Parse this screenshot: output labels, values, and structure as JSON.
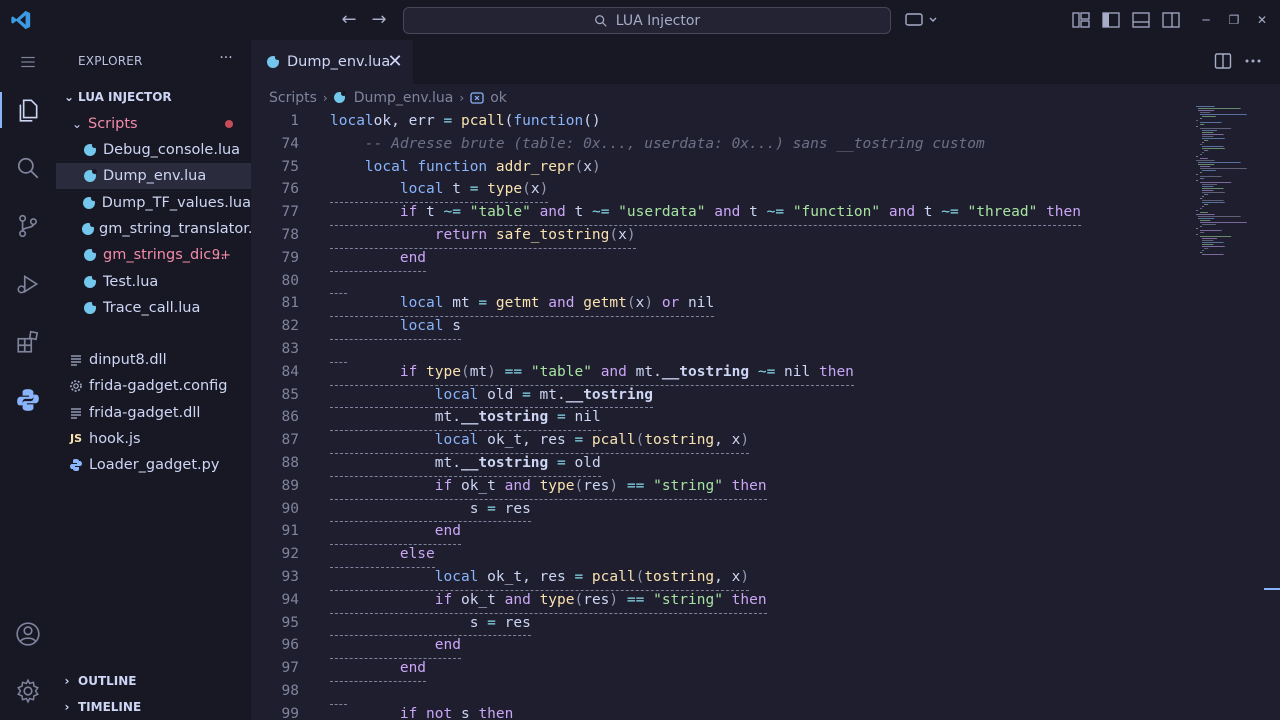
{
  "title_bar": {
    "search_text": "LUA Injector",
    "back_icon": "arrow-left-icon",
    "forward_icon": "arrow-right-icon"
  },
  "explorer": {
    "header": "EXPLORER",
    "more_label": "···",
    "root": "LUA INJECTOR",
    "folder": "Scripts",
    "files_in_folder": [
      {
        "name": "Debug_console.lua"
      },
      {
        "name": "Dump_env.lua"
      },
      {
        "name": "Dump_TF_values.lua"
      },
      {
        "name": "gm_string_translator..."
      },
      {
        "name": "gm_strings_dic...",
        "badge": "9+"
      },
      {
        "name": "Test.lua"
      },
      {
        "name": "Trace_call.lua"
      }
    ],
    "files_root": [
      {
        "name": "dinput8.dll"
      },
      {
        "name": "frida-gadget.config"
      },
      {
        "name": "frida-gadget.dll"
      },
      {
        "name": "hook.js",
        "icon_text": "JS"
      },
      {
        "name": "Loader_gadget.py"
      }
    ],
    "outline": "OUTLINE",
    "timeline": "TIMELINE"
  },
  "editor": {
    "tab_label": "Dump_env.lua",
    "close_glyph": "✕",
    "breadcrumb": [
      "Scripts",
      "Dump_env.lua",
      "ok"
    ],
    "lines": [
      {
        "n": "1",
        "indent": 0,
        "sticky": true,
        "t": [
          [
            "kw",
            "local"
          ],
          [
            "",
            "ok, err "
          ],
          [
            "op",
            "="
          ],
          [
            "",
            " "
          ],
          [
            "fn",
            "pcall"
          ],
          [
            "",
            "("
          ],
          [
            "kw",
            "function"
          ],
          [
            "",
            "()"
          ]
        ]
      },
      {
        "n": "74",
        "indent": 1,
        "sticky": true,
        "t": [
          [
            "cmt",
            "-- Adresse brute (table: 0x..., userdata: 0x...) sans __tostring custom"
          ]
        ]
      },
      {
        "n": "75",
        "indent": 1,
        "sticky": true,
        "t": [
          [
            "kw",
            "local"
          ],
          [
            "",
            " "
          ],
          [
            "kw",
            "function"
          ],
          [
            "",
            " "
          ],
          [
            "fn",
            "addr_repr"
          ],
          [
            "p",
            "("
          ],
          [
            "",
            "x"
          ],
          [
            "p",
            ")"
          ]
        ]
      },
      {
        "n": "76",
        "indent": 2,
        "u": true,
        "t": [
          [
            "kw",
            "local"
          ],
          [
            "",
            " t "
          ],
          [
            "op",
            "="
          ],
          [
            "",
            " "
          ],
          [
            "fn",
            "type"
          ],
          [
            "p",
            "("
          ],
          [
            "",
            "x"
          ],
          [
            "p",
            ")"
          ]
        ]
      },
      {
        "n": "77",
        "indent": 2,
        "u": true,
        "t": [
          [
            "kwc",
            "if"
          ],
          [
            "",
            " t "
          ],
          [
            "op",
            "~="
          ],
          [
            "",
            " "
          ],
          [
            "str",
            "\"table\""
          ],
          [
            "",
            " "
          ],
          [
            "kwc",
            "and"
          ],
          [
            "",
            " t "
          ],
          [
            "op",
            "~="
          ],
          [
            "",
            " "
          ],
          [
            "str",
            "\"userdata\""
          ],
          [
            "",
            " "
          ],
          [
            "kwc",
            "and"
          ],
          [
            "",
            " t "
          ],
          [
            "op",
            "~="
          ],
          [
            "",
            " "
          ],
          [
            "str",
            "\"function\""
          ],
          [
            "",
            " "
          ],
          [
            "kwc",
            "and"
          ],
          [
            "",
            " t "
          ],
          [
            "op",
            "~="
          ],
          [
            "",
            " "
          ],
          [
            "str",
            "\"thread\""
          ],
          [
            "",
            " "
          ],
          [
            "kwc",
            "then"
          ]
        ]
      },
      {
        "n": "78",
        "indent": 3,
        "u": true,
        "t": [
          [
            "kwc",
            "return"
          ],
          [
            "",
            " "
          ],
          [
            "fn",
            "safe_tostring"
          ],
          [
            "p",
            "("
          ],
          [
            "",
            "x"
          ],
          [
            "p",
            ")"
          ]
        ]
      },
      {
        "n": "79",
        "indent": 2,
        "u": true,
        "t": [
          [
            "kwc",
            "end"
          ]
        ]
      },
      {
        "n": "80",
        "indent": 0,
        "u": true,
        "t": [
          [
            "",
            ""
          ]
        ]
      },
      {
        "n": "81",
        "indent": 2,
        "u": true,
        "t": [
          [
            "kw",
            "local"
          ],
          [
            "",
            " mt "
          ],
          [
            "op",
            "="
          ],
          [
            "",
            " "
          ],
          [
            "fn",
            "getmt"
          ],
          [
            "",
            " "
          ],
          [
            "kwc",
            "and"
          ],
          [
            "",
            " "
          ],
          [
            "fn",
            "getmt"
          ],
          [
            "p",
            "("
          ],
          [
            "",
            "x"
          ],
          [
            "p",
            ")"
          ],
          [
            "",
            " "
          ],
          [
            "kwc",
            "or"
          ],
          [
            "",
            " nil"
          ]
        ]
      },
      {
        "n": "82",
        "indent": 2,
        "u": true,
        "t": [
          [
            "kw",
            "local"
          ],
          [
            "",
            " s"
          ]
        ]
      },
      {
        "n": "83",
        "indent": 0,
        "u": true,
        "t": [
          [
            "",
            ""
          ]
        ]
      },
      {
        "n": "84",
        "indent": 2,
        "u": true,
        "t": [
          [
            "kwc",
            "if"
          ],
          [
            "",
            " "
          ],
          [
            "fn",
            "type"
          ],
          [
            "p",
            "("
          ],
          [
            "",
            "mt"
          ],
          [
            "p",
            ")"
          ],
          [
            "",
            " "
          ],
          [
            "op",
            "=="
          ],
          [
            "",
            " "
          ],
          [
            "str",
            "\"table\""
          ],
          [
            "",
            " "
          ],
          [
            "kwc",
            "and"
          ],
          [
            "",
            " mt."
          ],
          [
            "b",
            "__tostring"
          ],
          [
            "",
            " "
          ],
          [
            "op",
            "~="
          ],
          [
            "",
            " nil "
          ],
          [
            "kwc",
            "then"
          ]
        ]
      },
      {
        "n": "85",
        "indent": 3,
        "u": true,
        "t": [
          [
            "kw",
            "local"
          ],
          [
            "",
            " old "
          ],
          [
            "op",
            "="
          ],
          [
            "",
            " mt."
          ],
          [
            "b",
            "__tostring"
          ]
        ]
      },
      {
        "n": "86",
        "indent": 3,
        "u": true,
        "t": [
          [
            "",
            "mt."
          ],
          [
            "b",
            "__tostring"
          ],
          [
            "",
            " "
          ],
          [
            "op",
            "="
          ],
          [
            "",
            " nil"
          ]
        ]
      },
      {
        "n": "87",
        "indent": 3,
        "u": true,
        "t": [
          [
            "kw",
            "local"
          ],
          [
            "",
            " ok_t, res "
          ],
          [
            "op",
            "="
          ],
          [
            "",
            " "
          ],
          [
            "fn",
            "pcall"
          ],
          [
            "p",
            "("
          ],
          [
            "fn",
            "tostring"
          ],
          [
            "",
            ", x"
          ],
          [
            "p",
            ")"
          ]
        ]
      },
      {
        "n": "88",
        "indent": 3,
        "u": true,
        "t": [
          [
            "",
            "mt."
          ],
          [
            "b",
            "__tostring"
          ],
          [
            "",
            " "
          ],
          [
            "op",
            "="
          ],
          [
            "",
            " old"
          ]
        ]
      },
      {
        "n": "89",
        "indent": 3,
        "u": true,
        "t": [
          [
            "kwc",
            "if"
          ],
          [
            "",
            " ok_t "
          ],
          [
            "kwc",
            "and"
          ],
          [
            "",
            " "
          ],
          [
            "fn",
            "type"
          ],
          [
            "p",
            "("
          ],
          [
            "",
            "res"
          ],
          [
            "p",
            ")"
          ],
          [
            "",
            " "
          ],
          [
            "op",
            "=="
          ],
          [
            "",
            " "
          ],
          [
            "str",
            "\"string\""
          ],
          [
            "",
            " "
          ],
          [
            "kwc",
            "then"
          ]
        ]
      },
      {
        "n": "90",
        "indent": 4,
        "u": true,
        "t": [
          [
            "",
            "s "
          ],
          [
            "op",
            "="
          ],
          [
            "",
            " res"
          ]
        ]
      },
      {
        "n": "91",
        "indent": 3,
        "u": true,
        "t": [
          [
            "kwc",
            "end"
          ]
        ]
      },
      {
        "n": "92",
        "indent": 2,
        "u": true,
        "t": [
          [
            "kwc",
            "else"
          ]
        ]
      },
      {
        "n": "93",
        "indent": 3,
        "u": true,
        "t": [
          [
            "kw",
            "local"
          ],
          [
            "",
            " ok_t, res "
          ],
          [
            "op",
            "="
          ],
          [
            "",
            " "
          ],
          [
            "fn",
            "pcall"
          ],
          [
            "p",
            "("
          ],
          [
            "fn",
            "tostring"
          ],
          [
            "",
            ", x"
          ],
          [
            "p",
            ")"
          ]
        ]
      },
      {
        "n": "94",
        "indent": 3,
        "u": true,
        "t": [
          [
            "kwc",
            "if"
          ],
          [
            "",
            " ok_t "
          ],
          [
            "kwc",
            "and"
          ],
          [
            "",
            " "
          ],
          [
            "fn",
            "type"
          ],
          [
            "p",
            "("
          ],
          [
            "",
            "res"
          ],
          [
            "p",
            ")"
          ],
          [
            "",
            " "
          ],
          [
            "op",
            "=="
          ],
          [
            "",
            " "
          ],
          [
            "str",
            "\"string\""
          ],
          [
            "",
            " "
          ],
          [
            "kwc",
            "then"
          ]
        ]
      },
      {
        "n": "95",
        "indent": 4,
        "u": true,
        "t": [
          [
            "",
            "s "
          ],
          [
            "op",
            "="
          ],
          [
            "",
            " res"
          ]
        ]
      },
      {
        "n": "96",
        "indent": 3,
        "u": true,
        "t": [
          [
            "kwc",
            "end"
          ]
        ]
      },
      {
        "n": "97",
        "indent": 2,
        "u": true,
        "t": [
          [
            "kwc",
            "end"
          ]
        ]
      },
      {
        "n": "98",
        "indent": 0,
        "u": true,
        "t": [
          [
            "",
            ""
          ]
        ]
      },
      {
        "n": "99",
        "indent": 2,
        "u": false,
        "t": [
          [
            "kwc",
            "if"
          ],
          [
            "",
            " "
          ],
          [
            "kwc",
            "not"
          ],
          [
            "",
            " s "
          ],
          [
            "kwc",
            "then"
          ]
        ]
      }
    ]
  },
  "colors": {
    "accent": "#89b4fa",
    "error": "#f38ba8",
    "keyword": "#89b4fa",
    "control": "#cba6f7",
    "string": "#a6e3a1",
    "function": "#f9e2af"
  }
}
